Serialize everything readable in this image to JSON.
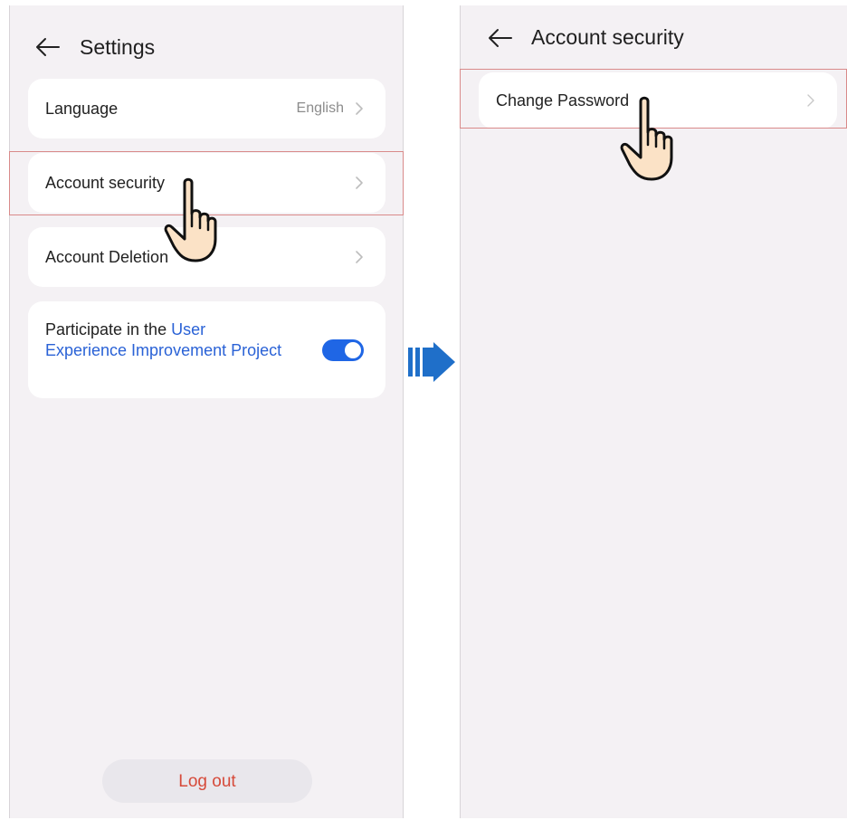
{
  "left_screen": {
    "title": "Settings",
    "items": [
      {
        "label": "Language",
        "value": "English"
      },
      {
        "label": "Account security"
      },
      {
        "label": "Account Deletion"
      }
    ],
    "ux_program": {
      "text_prefix": "Participate in the ",
      "link_text": "User Experience Improvement Project",
      "toggle_on": true
    },
    "logout_label": "Log out"
  },
  "right_screen": {
    "title": "Account security",
    "items": [
      {
        "label": "Change Password"
      }
    ]
  },
  "icons": {
    "back": "arrow-left-icon",
    "chevron": "chevron-right-icon",
    "pointer": "hand-pointer-icon",
    "transition": "double-arrow-right-icon"
  },
  "colors": {
    "screen_bg": "#f4f1f4",
    "card_bg": "#ffffff",
    "link": "#2a62d6",
    "toggle": "#1f66e5",
    "logout_text": "#d64a3a",
    "highlight_border": "#d98a8a",
    "transition_arrow": "#1f6fc9"
  }
}
